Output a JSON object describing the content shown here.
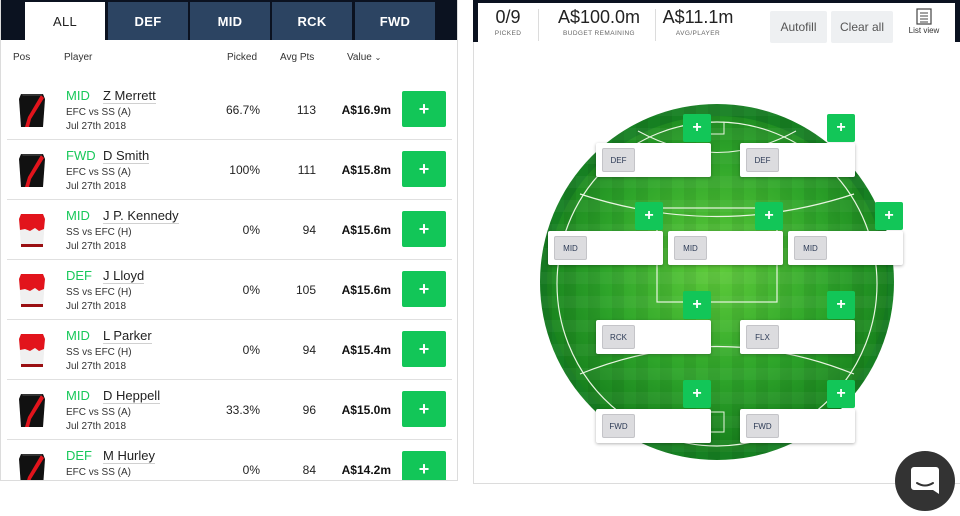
{
  "tabs": [
    {
      "label": "ALL",
      "active": true
    },
    {
      "label": "DEF",
      "active": false
    },
    {
      "label": "MID",
      "active": false
    },
    {
      "label": "RCK",
      "active": false
    },
    {
      "label": "FWD",
      "active": false
    }
  ],
  "columns": {
    "pos": "Pos",
    "player": "Player",
    "picked": "Picked",
    "avg_pts": "Avg Pts",
    "value": "Value",
    "sort_icon": "chevron-down-icon"
  },
  "players": [
    {
      "pos": "MID",
      "name": "Z Merrett",
      "match": "EFC vs SS (A)",
      "date": "Jul 27th 2018",
      "picked": "66.7%",
      "avg": "113",
      "value": "A$16.9m",
      "team": "EFC",
      "add": "+"
    },
    {
      "pos": "FWD",
      "name": "D Smith",
      "match": "EFC vs SS (A)",
      "date": "Jul 27th 2018",
      "picked": "100%",
      "avg": "111",
      "value": "A$15.8m",
      "team": "EFC",
      "add": "+"
    },
    {
      "pos": "MID",
      "name": "J P. Kennedy",
      "match": "SS vs EFC (H)",
      "date": "Jul 27th 2018",
      "picked": "0%",
      "avg": "94",
      "value": "A$15.6m",
      "team": "SS",
      "add": "+"
    },
    {
      "pos": "DEF",
      "name": "J Lloyd",
      "match": "SS vs EFC (H)",
      "date": "Jul 27th 2018",
      "picked": "0%",
      "avg": "105",
      "value": "A$15.6m",
      "team": "SS",
      "add": "+"
    },
    {
      "pos": "MID",
      "name": "L Parker",
      "match": "SS vs EFC (H)",
      "date": "Jul 27th 2018",
      "picked": "0%",
      "avg": "94",
      "value": "A$15.4m",
      "team": "SS",
      "add": "+"
    },
    {
      "pos": "MID",
      "name": "D Heppell",
      "match": "EFC vs SS (A)",
      "date": "Jul 27th 2018",
      "picked": "33.3%",
      "avg": "96",
      "value": "A$15.0m",
      "team": "EFC",
      "add": "+"
    },
    {
      "pos": "DEF",
      "name": "M Hurley",
      "match": "EFC vs SS (A)",
      "date": "",
      "picked": "0%",
      "avg": "84",
      "value": "A$14.2m",
      "team": "EFC",
      "add": "+"
    }
  ],
  "summary": {
    "picked": {
      "value": "0/9",
      "label": "PICKED"
    },
    "budget": {
      "value": "A$100.0m",
      "label": "BUDGET REMAINING"
    },
    "avg": {
      "value": "A$11.1m",
      "label": "AVG/PLAYER"
    },
    "autofill": "Autofill",
    "clear_all": "Clear all",
    "list_view": "List view"
  },
  "lineup": [
    {
      "pos": "DEF",
      "add": "+"
    },
    {
      "pos": "DEF",
      "add": "+"
    },
    {
      "pos": "MID",
      "add": "+"
    },
    {
      "pos": "MID",
      "add": "+"
    },
    {
      "pos": "MID",
      "add": "+"
    },
    {
      "pos": "RCK",
      "add": "+"
    },
    {
      "pos": "FLX",
      "add": "+"
    },
    {
      "pos": "FWD",
      "add": "+"
    },
    {
      "pos": "FWD",
      "add": "+"
    }
  ],
  "colors": {
    "accent_green": "#12c658",
    "tab_bg": "#2c4462",
    "header_dark": "#0b1220"
  }
}
